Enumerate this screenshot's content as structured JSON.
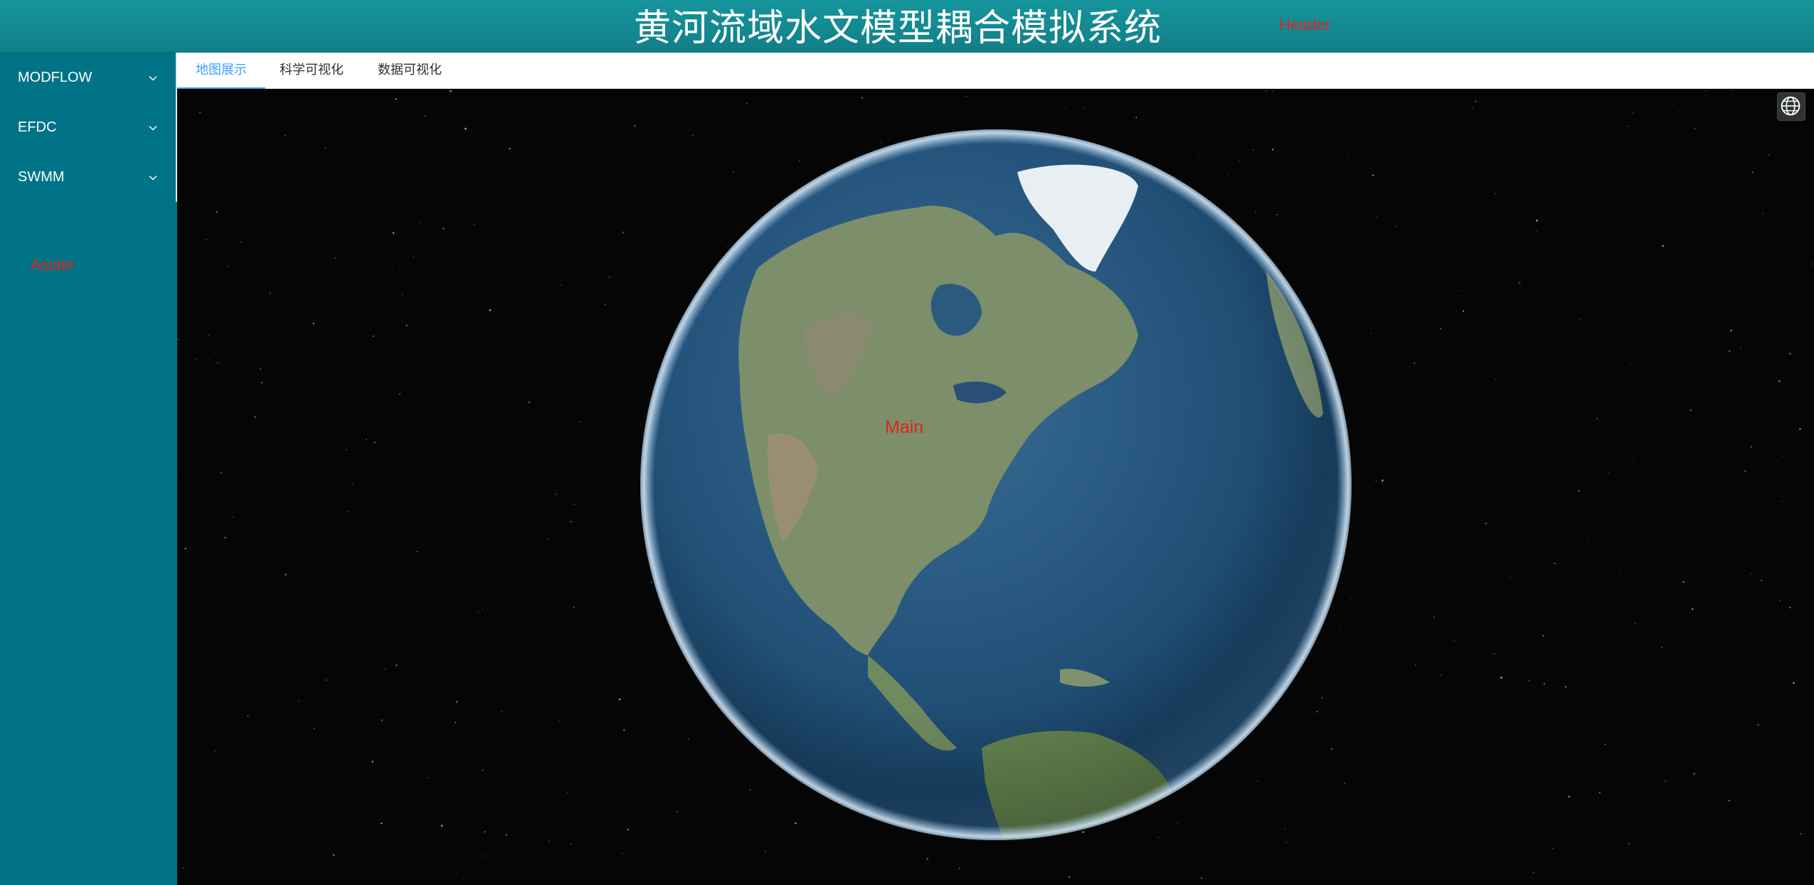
{
  "header": {
    "title": "黄河流域水文模型耦合模拟系统",
    "tag": "Header"
  },
  "aside": {
    "items": [
      {
        "label": "MODFLOW",
        "icon": "chevron-down-icon"
      },
      {
        "label": "EFDC",
        "icon": "chevron-down-icon"
      },
      {
        "label": "SWMM",
        "icon": "chevron-down-icon"
      }
    ],
    "tag": "Asider"
  },
  "tabs": [
    {
      "label": "地图展示",
      "active": true
    },
    {
      "label": "科学可视化",
      "active": false
    },
    {
      "label": "数据可视化",
      "active": false
    }
  ],
  "main": {
    "tag": "Main",
    "globe_button_icon": "globe-icon"
  },
  "colors": {
    "header_bg": "#138b92",
    "aside_bg": "#007386",
    "tab_active": "#409eff",
    "tag_red": "#e0241f",
    "space_bg": "#050505"
  }
}
